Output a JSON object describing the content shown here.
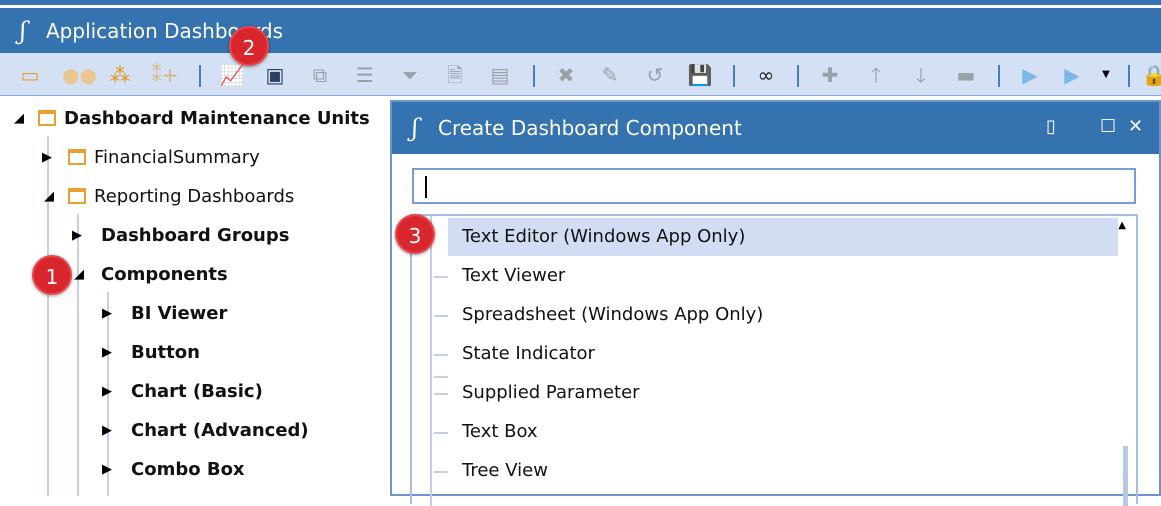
{
  "app": {
    "title": "Application Dashboards",
    "logo": "app-logo"
  },
  "toolbar": {
    "icons": [
      "new-maintenance-unit-icon",
      "group-icon",
      "component-group-icon",
      "add-member-icon",
      "chart-icon",
      "dashboard-icon",
      "component-icon",
      "list-icon",
      "filter-icon",
      "document-icon",
      "parameter-icon",
      "delete-icon",
      "edit-icon",
      "refresh-icon",
      "save-icon",
      "search-binoculars-icon",
      "add-icon",
      "move-up-icon",
      "move-down-icon",
      "remove-icon",
      "export-icon",
      "import-icon",
      "dropdown-caret-icon",
      "lock-icon"
    ]
  },
  "badges": {
    "one": "1",
    "two": "2",
    "three": "3"
  },
  "tree": {
    "root": "Dashboard Maintenance Units",
    "financial": "FinancialSummary",
    "reporting": "Reporting Dashboards",
    "groups": "Dashboard Groups",
    "components": "Components",
    "children": [
      "BI Viewer",
      "Button",
      "Chart (Basic)",
      "Chart (Advanced)",
      "Combo Box"
    ]
  },
  "dialog": {
    "title": "Create Dashboard Component",
    "search_value": "",
    "items": [
      "Text Editor (Windows App Only)",
      "Text Viewer",
      "Spreadsheet (Windows App Only)",
      "State Indicator",
      "Supplied Parameter",
      "Text Box",
      "Tree View"
    ],
    "selected_index": 0
  },
  "colors": {
    "accent": "#3472b0",
    "toolbar": "#d4e0f4",
    "selection": "#d2ddf4",
    "badge": "#d9262c"
  }
}
